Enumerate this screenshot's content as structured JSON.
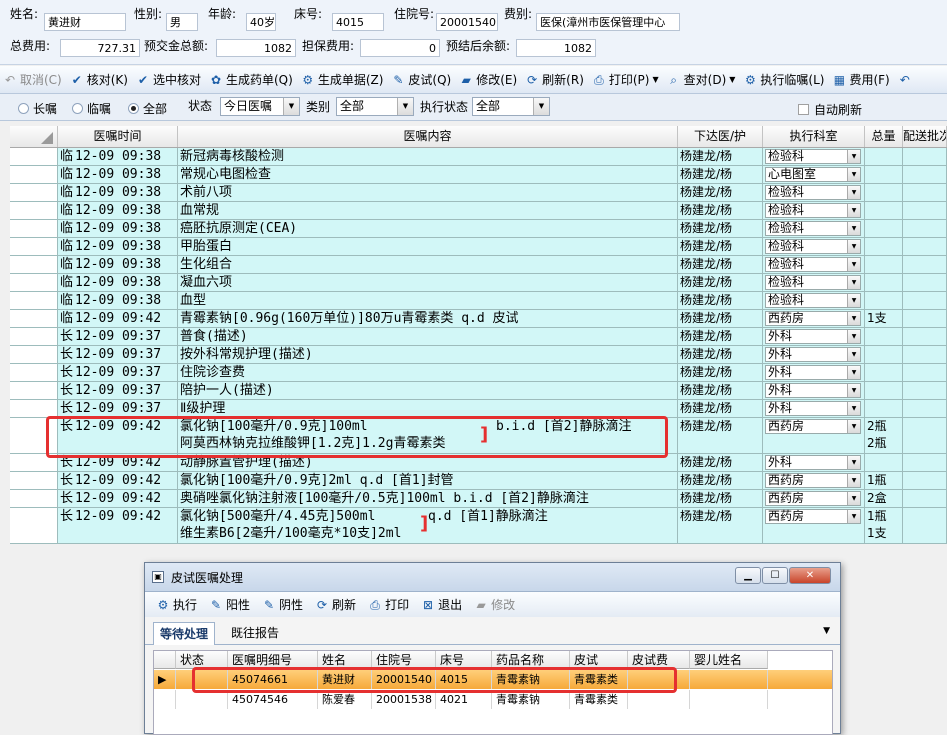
{
  "patient": {
    "name_label": "姓名:",
    "name": "黄进财",
    "gender_label": "性别:",
    "gender": "男",
    "age_label": "年龄:",
    "age": "40岁",
    "bed_label": "床号:",
    "bed": "4015",
    "admission_label": "住院号:",
    "admission_no": "20001540",
    "payer_label": "费别:",
    "payer": "医保(漳州市医保管理中心",
    "total_label": "总费用:",
    "total": "727.31",
    "prepay_label": "预交金总额:",
    "prepay": "1082",
    "guarantee_label": "担保费用:",
    "guarantee": "0",
    "balance_label": "预结后余额:",
    "balance": "1082"
  },
  "toolbar": [
    {
      "label": "取消(C)",
      "icon": "undo-icon",
      "glyph": "↶",
      "disabled": true
    },
    {
      "label": "核对(K)",
      "icon": "check-icon",
      "glyph": "✔"
    },
    {
      "label": "选中核对",
      "icon": "check-icon",
      "glyph": "✔"
    },
    {
      "label": "生成药单(Q)",
      "icon": "medicine-icon",
      "glyph": "✿"
    },
    {
      "label": "生成单据(Z)",
      "icon": "gear-icon",
      "glyph": "⚙"
    },
    {
      "label": "皮试(Q)",
      "icon": "pen-icon",
      "glyph": "✎"
    },
    {
      "label": "修改(E)",
      "icon": "eraser-icon",
      "glyph": "▰"
    },
    {
      "label": "刷新(R)",
      "icon": "refresh-icon",
      "glyph": "⟳"
    },
    {
      "label": "打印(P)",
      "icon": "printer-icon",
      "glyph": "⎙",
      "dropdown": true
    },
    {
      "label": "查对(D)",
      "icon": "search-icon",
      "glyph": "⌕",
      "dropdown": true
    },
    {
      "label": "执行临嘱(L)",
      "icon": "gear-icon",
      "glyph": "⚙"
    },
    {
      "label": "费用(F)",
      "icon": "calculator-icon",
      "glyph": "▦"
    },
    {
      "label": "",
      "icon": "undo-icon",
      "glyph": "↶"
    }
  ],
  "filter": {
    "radio_long": "长嘱",
    "radio_temp": "临嘱",
    "radio_all": "全部",
    "status_label": "状态",
    "status_value": "今日医嘱",
    "category_label": "类别",
    "category_value": "全部",
    "exec_label": "执行状态",
    "exec_value": "全部",
    "auto_refresh": "自动刷新"
  },
  "grid": {
    "headers": [
      "",
      "医嘱时间",
      "医嘱内容",
      "下达医/护",
      "执行科室",
      "总量",
      "配送批次"
    ],
    "rows": [
      {
        "type": "临",
        "time": "12-09 09:38",
        "lines": [
          "新冠病毒核酸检测"
        ],
        "doctor": "杨建龙/杨",
        "dept": "检验科",
        "qty": []
      },
      {
        "type": "临",
        "time": "12-09 09:38",
        "lines": [
          "常规心电图检查"
        ],
        "doctor": "杨建龙/杨",
        "dept": "心电图室",
        "qty": []
      },
      {
        "type": "临",
        "time": "12-09 09:38",
        "lines": [
          "术前八项"
        ],
        "doctor": "杨建龙/杨",
        "dept": "检验科",
        "qty": []
      },
      {
        "type": "临",
        "time": "12-09 09:38",
        "lines": [
          "血常规"
        ],
        "doctor": "杨建龙/杨",
        "dept": "检验科",
        "qty": []
      },
      {
        "type": "临",
        "time": "12-09 09:38",
        "lines": [
          "癌胚抗原测定(CEA)"
        ],
        "doctor": "杨建龙/杨",
        "dept": "检验科",
        "qty": []
      },
      {
        "type": "临",
        "time": "12-09 09:38",
        "lines": [
          "甲胎蛋白"
        ],
        "doctor": "杨建龙/杨",
        "dept": "检验科",
        "qty": []
      },
      {
        "type": "临",
        "time": "12-09 09:38",
        "lines": [
          "生化组合"
        ],
        "doctor": "杨建龙/杨",
        "dept": "检验科",
        "qty": []
      },
      {
        "type": "临",
        "time": "12-09 09:38",
        "lines": [
          "凝血六项"
        ],
        "doctor": "杨建龙/杨",
        "dept": "检验科",
        "qty": []
      },
      {
        "type": "临",
        "time": "12-09 09:38",
        "lines": [
          "血型"
        ],
        "doctor": "杨建龙/杨",
        "dept": "检验科",
        "qty": []
      },
      {
        "type": "临",
        "time": "12-09 09:42",
        "lines": [
          "青霉素钠[0.96g(160万单位)]80万u青霉素类  q.d 皮试"
        ],
        "doctor": "杨建龙/杨",
        "dept": "西药房",
        "qty": [
          "1支"
        ]
      },
      {
        "type": "长",
        "time": "12-09 09:37",
        "lines": [
          "普食(描述)"
        ],
        "doctor": "杨建龙/杨",
        "dept": "外科",
        "qty": []
      },
      {
        "type": "长",
        "time": "12-09 09:37",
        "lines": [
          "按外科常规护理(描述)"
        ],
        "doctor": "杨建龙/杨",
        "dept": "外科",
        "qty": []
      },
      {
        "type": "长",
        "time": "12-09 09:37",
        "lines": [
          "住院诊查费"
        ],
        "doctor": "杨建龙/杨",
        "dept": "外科",
        "qty": []
      },
      {
        "type": "长",
        "time": "12-09 09:37",
        "lines": [
          "陪护一人(描述)"
        ],
        "doctor": "杨建龙/杨",
        "dept": "外科",
        "qty": []
      },
      {
        "type": "长",
        "time": "12-09 09:37",
        "lines": [
          "Ⅱ级护理"
        ],
        "doctor": "杨建龙/杨",
        "dept": "外科",
        "qty": []
      },
      {
        "type": "长",
        "time": "12-09 09:42",
        "lines": [
          "氯化钠[100毫升/0.9克]100ml",
          "阿莫西林钠克拉维酸钾[1.2克]1.2g青霉素类"
        ],
        "extra": "b.i.d [首2]静脉滴注",
        "doctor": "杨建龙/杨",
        "dept": "西药房",
        "qty": [
          "2瓶",
          "2瓶"
        ]
      },
      {
        "type": "长",
        "time": "12-09 09:42",
        "lines": [
          "动静脉置管护理(描述)"
        ],
        "doctor": "杨建龙/杨",
        "dept": "外科",
        "qty": []
      },
      {
        "type": "长",
        "time": "12-09 09:42",
        "lines": [
          "氯化钠[100毫升/0.9克]2ml  q.d [首1]封管"
        ],
        "doctor": "杨建龙/杨",
        "dept": "西药房",
        "qty": [
          "1瓶"
        ]
      },
      {
        "type": "长",
        "time": "12-09 09:42",
        "lines": [
          "奥硝唑氯化钠注射液[100毫升/0.5克]100ml  b.i.d [首2]静脉滴注"
        ],
        "doctor": "杨建龙/杨",
        "dept": "西药房",
        "qty": [
          "2盒"
        ]
      },
      {
        "type": "长",
        "time": "12-09 09:42",
        "lines": [
          "氯化钠[500毫升/4.45克]500ml",
          "维生素B6[2毫升/100毫克*10支]2ml"
        ],
        "extra": "q.d [首1]静脉滴注",
        "doctor": "杨建龙/杨",
        "dept": "西药房",
        "qty": [
          "1瓶",
          "1支"
        ]
      }
    ]
  },
  "dialog": {
    "title": "皮试医嘱处理",
    "toolbar": [
      {
        "label": "执行",
        "icon": "gear-icon",
        "glyph": "⚙"
      },
      {
        "label": "阳性",
        "icon": "pen-icon",
        "glyph": "✎"
      },
      {
        "label": "阴性",
        "icon": "pen-icon",
        "glyph": "✎"
      },
      {
        "label": "刷新",
        "icon": "refresh-icon",
        "glyph": "⟳"
      },
      {
        "label": "打印",
        "icon": "printer-icon",
        "glyph": "⎙"
      },
      {
        "label": "退出",
        "icon": "exit-icon",
        "glyph": "⊠"
      },
      {
        "label": "修改",
        "icon": "eraser-icon",
        "glyph": "▰",
        "disabled": true
      }
    ],
    "tabs": [
      "等待处理",
      "既往报告"
    ],
    "headers": [
      "状态",
      "医嘱明细号",
      "姓名",
      "住院号",
      "床号",
      "药品名称",
      "皮试",
      "皮试费",
      "婴儿姓名"
    ],
    "rows": [
      [
        "",
        "45074661",
        "黄进财",
        "20001540",
        "4015",
        "青霉素钠",
        "青霉素类",
        "",
        ""
      ],
      [
        "",
        "45074546",
        "陈爱春",
        "20001538",
        "4021",
        "青霉素钠",
        "青霉素类",
        "",
        ""
      ]
    ]
  }
}
